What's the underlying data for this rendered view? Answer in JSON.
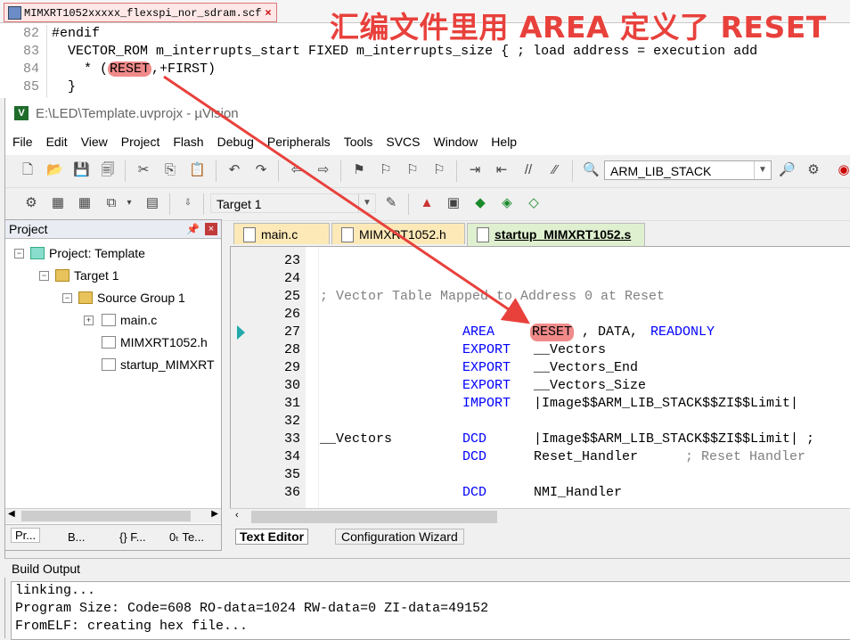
{
  "scatter_file": {
    "tab_label": "MIMXRT1052xxxxx_flexspi_nor_sdram.scf",
    "lines": [
      {
        "num": "82",
        "pre": "#endif",
        "hl": "",
        "post": ""
      },
      {
        "num": "83",
        "pre": "  VECTOR_ROM m_interrupts_start FIXED m_interrupts_size { ; load address = execution add",
        "hl": "",
        "post": ""
      },
      {
        "num": "84",
        "pre": "    * (",
        "hl": "RESET",
        "post": ",+FIRST)"
      },
      {
        "num": "85",
        "pre": "  }",
        "hl": "",
        "post": ""
      }
    ]
  },
  "annotation": "汇编文件里用 AREA 定义了 RESET",
  "window": {
    "title": "E:\\LED\\Template.uvprojx - µVision",
    "logo": "V"
  },
  "menu": [
    "File",
    "Edit",
    "View",
    "Project",
    "Flash",
    "Debug",
    "Peripherals",
    "Tools",
    "SVCS",
    "Window",
    "Help"
  ],
  "toolbar": {
    "search_combo": "ARM_LIB_STACK",
    "target_combo": "Target 1"
  },
  "project_panel": {
    "title": "Project",
    "pin": "ᵖ",
    "close": "×",
    "tree": {
      "root": "Project: Template",
      "target": "Target 1",
      "group": "Source Group 1",
      "files": [
        "main.c",
        "MIMXRT1052.h",
        "startup_MIMXRT"
      ]
    },
    "tabs": [
      "Pr...",
      "B...",
      "{} F...",
      "0ₜ Te..."
    ]
  },
  "editor": {
    "tabs": [
      "main.c",
      "MIMXRT1052.h",
      "startup_MIMXRT1052.s"
    ],
    "active_tab": "startup_MIMXRT1052.s",
    "lines": [
      {
        "n": "23",
        "label": "",
        "op": "",
        "args": "",
        "comment": ""
      },
      {
        "n": "24",
        "label": "",
        "op": "",
        "args": "",
        "comment": ""
      },
      {
        "n": "25",
        "label": "",
        "op": "",
        "args": "",
        "comment": "; Vector Table Mapped to Address 0 at Reset"
      },
      {
        "n": "26",
        "label": "",
        "op": "",
        "args": "",
        "comment": ""
      },
      {
        "n": "27",
        "label": "",
        "op": "AREA",
        "args": "RESET",
        "args2": ", DATA, ",
        "args3": "READONLY",
        "comment": ""
      },
      {
        "n": "28",
        "label": "",
        "op": "EXPORT",
        "args": "__Vectors",
        "comment": ""
      },
      {
        "n": "29",
        "label": "",
        "op": "EXPORT",
        "args": "__Vectors_End",
        "comment": ""
      },
      {
        "n": "30",
        "label": "",
        "op": "EXPORT",
        "args": "__Vectors_Size",
        "comment": ""
      },
      {
        "n": "31",
        "label": "",
        "op": "IMPORT",
        "args": "|Image$$ARM_LIB_STACK$$ZI$$Limit|",
        "comment": ""
      },
      {
        "n": "32",
        "label": "",
        "op": "",
        "args": "",
        "comment": ""
      },
      {
        "n": "33",
        "label": "__Vectors",
        "op": "DCD",
        "args": "|Image$$ARM_LIB_STACK$$ZI$$Limit| ;",
        "comment": ""
      },
      {
        "n": "34",
        "label": "",
        "op": "DCD",
        "args": "Reset_Handler",
        "comment": "; Reset Handler"
      },
      {
        "n": "35",
        "label": "",
        "op": "",
        "args": "",
        "comment": ""
      },
      {
        "n": "36",
        "label": "",
        "op": "DCD",
        "args": "NMI_Handler",
        "comment": ""
      }
    ],
    "bottom_tabs": [
      "Text Editor",
      "Configuration Wizard"
    ]
  },
  "build_output": {
    "title": "Build Output",
    "lines": [
      "linking...",
      "Program Size: Code=608 RO-data=1024 RW-data=0 ZI-data=49152",
      "FromELF: creating hex file..."
    ]
  },
  "colors": {
    "annotation": "#e8413c",
    "keyword": "#0000ff",
    "comment": "#808080",
    "highlight": "#f08a8a"
  }
}
